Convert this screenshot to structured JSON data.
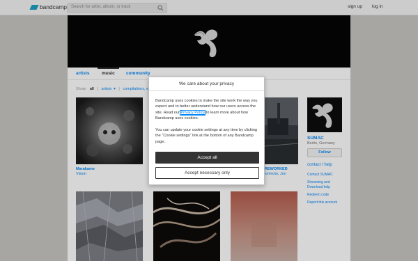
{
  "topbar": {
    "brand": "bandcamp",
    "search_placeholder": "Search for artist, album, or track",
    "signup": "sign up",
    "login": "log in"
  },
  "nav": {
    "artists": "artists",
    "music": "music",
    "community": "community"
  },
  "filters": {
    "show_label": "Show:",
    "all": "all",
    "artists": "artists",
    "compilations": "compilations, et"
  },
  "releases": [
    {
      "title": "Marakame",
      "subtitle": "Vision"
    },
    {
      "title": "REWORKED",
      "subtitle": "Morimoto, Jon"
    }
  ],
  "sidebar": {
    "name": "SUMAC",
    "location": "Berlin, Germany",
    "follow": "Follow",
    "contact": "contact / help",
    "links": [
      "Contact SUMAC",
      "Streaming and",
      "Download help",
      "Redeem code",
      "Report this account"
    ]
  },
  "modal": {
    "title": "We care about your privacy",
    "p1_before": "Bandcamp uses cookies to make the site work the way you expect and to better understand how our users access the site. Read our ",
    "privacy_link": "Privacy Policy",
    "p1_after": " to learn more about how Bandcamp uses cookies.",
    "p2": "You can update your cookie settings at any time by clicking the \"Cookie settings\" link at the bottom of any Bandcamp page.",
    "accept_all": "Accept all",
    "accept_necessary": "Accept necessary only"
  },
  "colors": {
    "link": "#0687f5",
    "brand_mark": "#1da0c3",
    "button_dark": "#333333"
  }
}
